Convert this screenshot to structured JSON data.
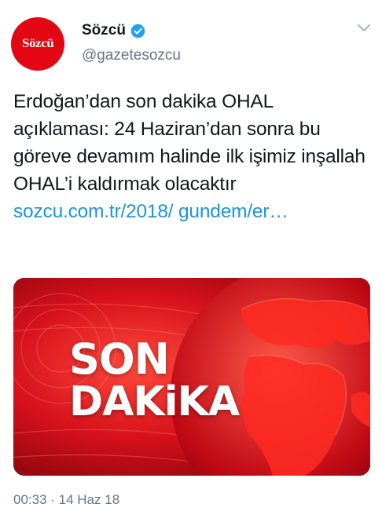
{
  "account": {
    "avatar_text": "Sözcü",
    "name": "Sözcü",
    "handle": "@gazetesozcu",
    "verified": true,
    "brand_color": "#e30613"
  },
  "tweet": {
    "text": "Erdoğan’dan son dakika OHAL açıklaması: 24 Haziran’dan sonra bu göreve devamım halinde ilk işimiz inşallah OHAL’i kaldırmak olacaktır ",
    "link_text": "sozcu.com.tr/2018/ gundem/er…",
    "link_color": "#1b95e0"
  },
  "media": {
    "line1": "SON",
    "line2": "DAKiKA",
    "background_color": "#c8101c"
  },
  "timestamp": "00:33 · 14 Haz 18",
  "icons": {
    "verified": "verified-badge-icon",
    "menu": "chevron-down-icon"
  }
}
